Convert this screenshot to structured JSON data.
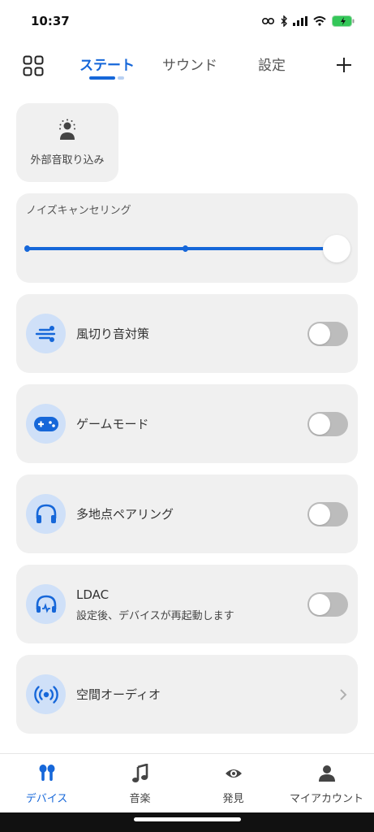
{
  "status_bar": {
    "time": "10:37",
    "icons": [
      "key-icon",
      "bluetooth-icon",
      "cellular-signal-icon",
      "wifi-icon",
      "battery-charging-icon"
    ]
  },
  "top_nav": {
    "tabs": [
      {
        "label": "ステート",
        "active": true
      },
      {
        "label": "サウンド",
        "active": false
      },
      {
        "label": "設定",
        "active": false
      }
    ],
    "left_icon": "grid-icon",
    "right_icon": "plus-icon"
  },
  "ambient": {
    "label": "外部音取り込み",
    "icon": "ambient-sound-icon"
  },
  "noise_cancelling": {
    "label": "ノイズキャンセリング",
    "level_fraction": 1.0,
    "stops": 3
  },
  "features": [
    {
      "label": "風切り音対策",
      "icon": "wind-icon",
      "toggle_on": false
    },
    {
      "label": "ゲームモード",
      "icon": "gamepad-icon",
      "toggle_on": false
    },
    {
      "label": "多地点ペアリング",
      "icon": "headphones-icon",
      "toggle_on": false
    },
    {
      "label": "LDAC",
      "sublabel": "設定後、デバイスが再起動します",
      "icon": "ldac-headphones-icon",
      "toggle_on": false
    },
    {
      "label": "空間オーディオ",
      "icon": "spatial-audio-icon",
      "has_chevron": true
    }
  ],
  "bottom_tabs": [
    {
      "label": "デバイス",
      "icon": "earbuds-icon",
      "active": true
    },
    {
      "label": "音楽",
      "icon": "music-note-icon",
      "active": false
    },
    {
      "label": "発見",
      "icon": "eye-icon",
      "active": false
    },
    {
      "label": "マイアカウント",
      "icon": "person-icon",
      "active": false
    }
  ],
  "colors": {
    "accent": "#1667d9",
    "card_bg": "#f0f0f0",
    "icon_circle_bg": "#cfe0f8",
    "toggle_off": "#bcbcbc"
  }
}
